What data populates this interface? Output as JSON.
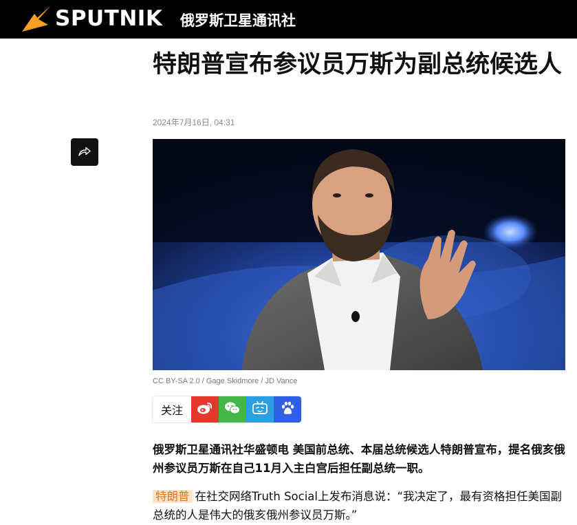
{
  "header": {
    "brand": "SPUTNIK",
    "brand_sub": "俄罗斯卫星通讯社"
  },
  "colors": {
    "header_bg": "#000000",
    "logo": "#f8a024",
    "tag_bg": "#fbe3cc",
    "tag_text": "#e8751a",
    "weibo": "#e6372b",
    "wechat": "#43b649",
    "bilibili": "#2aa0e2",
    "baidu": "#2f5fe3"
  },
  "article": {
    "title": "特朗普宣布参议员万斯为副总统候选人",
    "date": "2024年7月16日, 04:31",
    "photo_caption": "CC BY-SA 2.0 / Gage Skidmore / JD Vance",
    "follow_label": "关注",
    "lead": "俄罗斯卫星通讯社华盛顿电 美国前总统、本届总统候选人特朗普宣布，提名俄亥俄州参议员万斯在自己11月入主白宫后担任副总统一职。",
    "para_tag": "特朗普",
    "para_text": "在社交网络Truth Social上发布消息说：“我决定了，最有资格担任美国副总统的人是伟大的俄亥俄州参议员万斯。”"
  },
  "icons": {
    "share": "share-arrow-icon",
    "weibo": "weibo-icon",
    "wechat": "wechat-icon",
    "bilibili": "bilibili-icon",
    "baidu": "baidu-icon"
  }
}
